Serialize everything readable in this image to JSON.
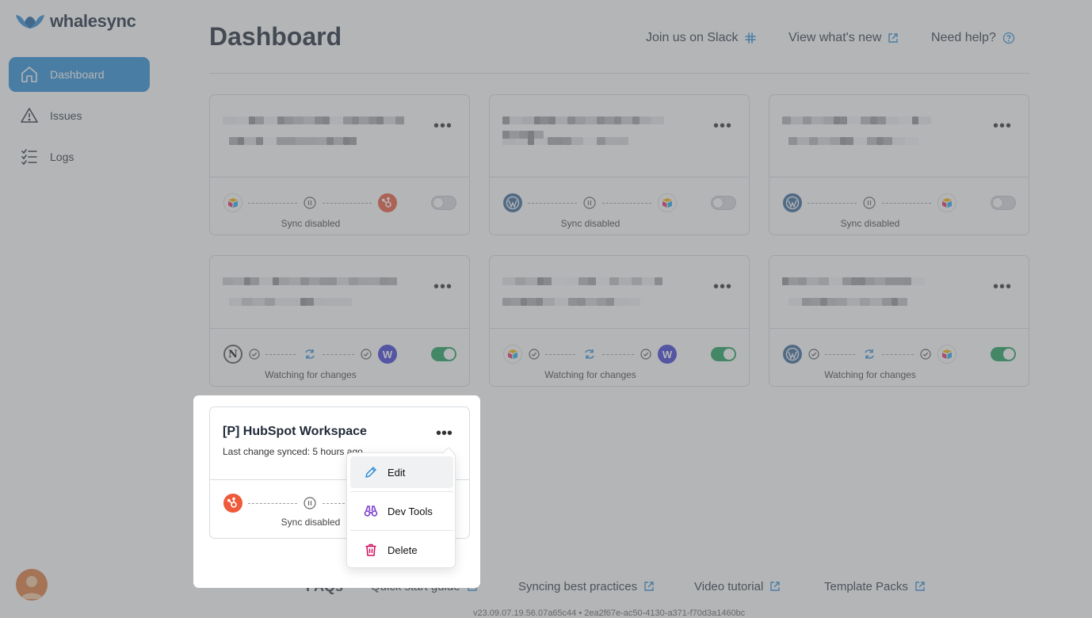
{
  "app": {
    "name": "whalesync"
  },
  "sidebar": {
    "items": [
      {
        "label": "Dashboard",
        "icon": "home-icon",
        "active": true
      },
      {
        "label": "Issues",
        "icon": "warning-icon",
        "active": false
      },
      {
        "label": "Logs",
        "icon": "checklist-icon",
        "active": false
      }
    ]
  },
  "header": {
    "title": "Dashboard",
    "links": [
      {
        "label": "Join us on Slack",
        "icon": "slack-icon"
      },
      {
        "label": "View what's new",
        "icon": "external-link-icon"
      },
      {
        "label": "Need help?",
        "icon": "help-circle-icon"
      }
    ]
  },
  "cards": [
    {
      "left_app": "airtable",
      "right_app": "hubspot",
      "status": "Sync disabled",
      "enabled": false
    },
    {
      "left_app": "wordpress",
      "right_app": "airtable",
      "status": "Sync disabled",
      "enabled": false
    },
    {
      "left_app": "wordpress",
      "right_app": "airtable",
      "status": "Sync disabled",
      "enabled": false
    },
    {
      "left_app": "notion",
      "right_app": "webflow",
      "status": "Watching for changes",
      "enabled": true
    },
    {
      "left_app": "airtable",
      "right_app": "webflow",
      "status": "Watching for changes",
      "enabled": true
    },
    {
      "left_app": "wordpress",
      "right_app": "airtable",
      "status": "Watching for changes",
      "enabled": true
    }
  ],
  "highlighted_card": {
    "title": "[P] HubSpot Workspace",
    "subtitle": "Last change synced: 5 hours ago",
    "status": "Sync disabled",
    "left_app": "hubspot"
  },
  "context_menu": {
    "items": [
      {
        "label": "Edit",
        "icon": "pencil-icon"
      },
      {
        "label": "Dev Tools",
        "icon": "binoculars-icon"
      },
      {
        "label": "Delete",
        "icon": "trash-icon"
      }
    ]
  },
  "footer": {
    "faqs_label": "FAQs",
    "links": [
      {
        "label": "Quick start guide"
      },
      {
        "label": "Syncing best practices"
      },
      {
        "label": "Video tutorial"
      },
      {
        "label": "Template Packs"
      }
    ],
    "version": "v23.09.07.19.56.07a65c44 • 2ea2f67e-ac50-4130-a371-f70d3a1460bc"
  },
  "colors": {
    "accent": "#2b8fd6",
    "toggle_on": "#1fa35d",
    "hubspot": "#ef5a3b",
    "webflow": "#3e3ed6",
    "wordpress": "#3a6a9a",
    "delete": "#d1105f",
    "devtools": "#7b3fd1"
  }
}
